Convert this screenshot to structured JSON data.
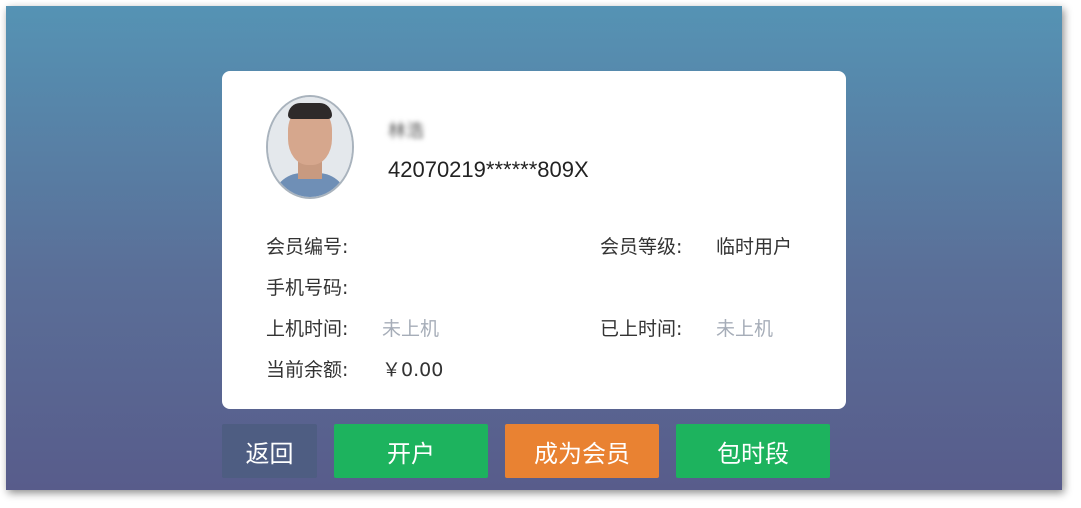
{
  "card": {
    "name": "林浩",
    "id_number": "42070219******809X",
    "fields": {
      "member_no_label": "会员编号:",
      "member_no_value": "",
      "member_level_label": "会员等级:",
      "member_level_value": "临时用户",
      "phone_label": "手机号码:",
      "phone_value": "",
      "login_time_label": "上机时间:",
      "login_time_value": "未上机",
      "elapsed_label": "已上时间:",
      "elapsed_value": "未上机",
      "balance_label": "当前余额:",
      "balance_value": "￥0.00"
    }
  },
  "buttons": {
    "back": "返回",
    "open_account": "开户",
    "become_member": "成为会员",
    "time_package": "包时段"
  },
  "colors": {
    "green": "#1db35e",
    "orange": "#e98232",
    "slate": "#4e5d82"
  },
  "icons": {
    "avatar": "user-photo"
  }
}
